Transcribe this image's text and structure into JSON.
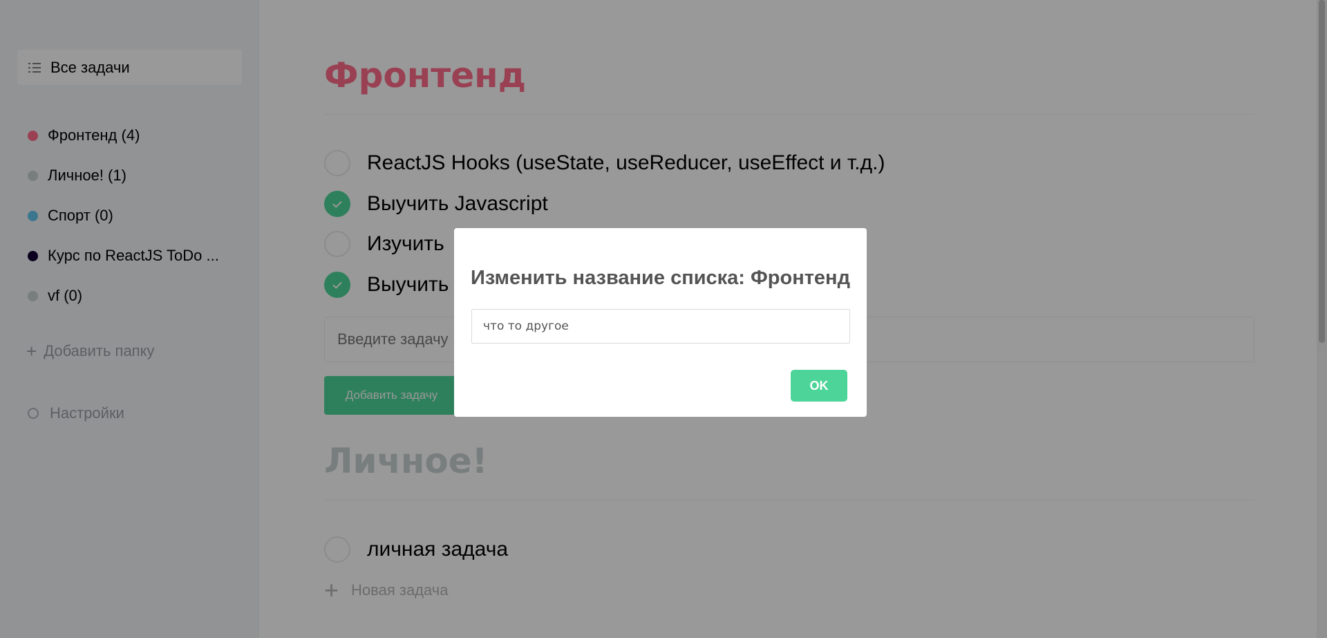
{
  "sidebar": {
    "all_tasks_label": "Все задачи",
    "folders": [
      {
        "name": "Фронтенд (4)",
        "color": "#ff6b8b"
      },
      {
        "name": "Личное! (1)",
        "color": "#c9d1d3"
      },
      {
        "name": "Спорт (0)",
        "color": "#64c4ed"
      },
      {
        "name": "Курс по ReactJS ToDo ...",
        "color": "#110133"
      },
      {
        "name": "vf (0)",
        "color": "#c9d1d3"
      }
    ],
    "add_folder_label": "Добавить папку",
    "settings_label": "Настройки"
  },
  "main": {
    "frontend": {
      "title": "Фронтенд",
      "color": "#ff6b8b",
      "tasks": [
        {
          "text": "ReactJS Hooks (useState, useReducer, useEffect и т.д.)",
          "done": false
        },
        {
          "text": "Выучить Javascript",
          "done": true
        },
        {
          "text": "Изучить",
          "done": false
        },
        {
          "text": "Выучить",
          "done": true
        }
      ],
      "input_placeholder": "Введите задачу",
      "add_button_label": "Добавить задачу"
    },
    "personal": {
      "title": "Личное!",
      "color": "#c9d1d3",
      "tasks": [
        {
          "text": "личная задача",
          "done": false
        }
      ],
      "new_task_label": "Новая задача"
    }
  },
  "modal": {
    "title": "Изменить название списка: Фронтенд",
    "input_value": "что то другое",
    "ok_label": "OK"
  }
}
